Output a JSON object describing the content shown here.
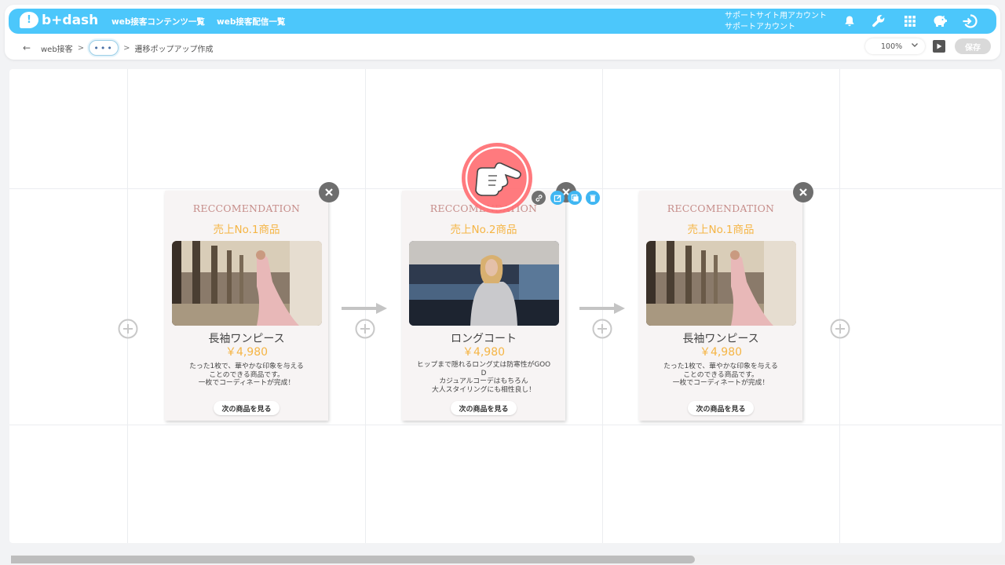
{
  "app": {
    "logo_text": "b+dash",
    "logo_mark": "!"
  },
  "nav": [
    {
      "label": "web接客コンテンツ一覧"
    },
    {
      "label": "web接客配信一覧"
    }
  ],
  "account": {
    "line1": "サポートサイト用アカウント",
    "line2": "サポートアカウント"
  },
  "breadcrumb": {
    "root": "web接客",
    "sep": ">",
    "ellipsis": "•••",
    "current": "遷移ポップアップ作成"
  },
  "toolbar": {
    "zoom": "100%",
    "save_label": "保存"
  },
  "colors": {
    "brand": "#4cc7fb",
    "accent": "#f5b545",
    "card_title": "#c68d8a"
  },
  "cards": [
    {
      "en_title": "RECCOMENDATION",
      "rank": "売上No.1商品",
      "name": "長袖ワンピース",
      "price": "￥4,980",
      "desc1": "たった1枚で、華やかな印象を与える",
      "desc2": "ことのできる商品です。",
      "desc3": "一枚でコーディネートが完成！",
      "button": "次の商品を見る"
    },
    {
      "en_title": "RECCOMENDATION",
      "rank": "売上No.2商品",
      "name": "ロングコート",
      "price": "￥4,980",
      "desc1": "ヒップまで隠れるロング丈は防寒性がGOO",
      "desc2": "D",
      "desc3": "カジュアルコーデはもちろん",
      "desc4": "大人スタイリングにも相性良し！",
      "button": "次の商品を見る"
    },
    {
      "en_title": "RECCOMENDATION",
      "rank": "売上No.1商品",
      "name": "長袖ワンピース",
      "price": "￥4,980",
      "desc1": "たった1枚で、華やかな印象を与える",
      "desc2": "ことのできる商品です。",
      "desc3": "一枚でコーディネートが完成！",
      "button": "次の商品を見る"
    }
  ],
  "scroll": {
    "position": 0.69
  }
}
